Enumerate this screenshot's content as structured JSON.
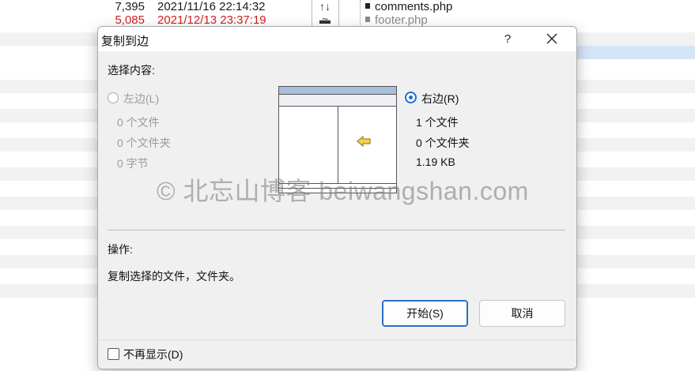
{
  "background": {
    "rows": [
      {
        "size": "7,395",
        "date": "2021/11/16 22:14:32",
        "mid": "↑↓ ▬",
        "file": "comments.php",
        "red": false,
        "gray": false
      },
      {
        "size": "5,085",
        "date": "2021/12/13 23:37:19",
        "mid": "≈",
        "file": "footer.php",
        "red": true,
        "gray": true
      }
    ]
  },
  "dialog": {
    "title": "复制到边",
    "help_label": "?",
    "close_label": "✕",
    "content_label": "选择内容:",
    "left": {
      "label": "左边(L)",
      "files": "0 个文件",
      "folders": "0 个文件夹",
      "bytes": "0 字节"
    },
    "right": {
      "label": "右边(R)",
      "files": "1 个文件",
      "folders": "0 个文件夹",
      "bytes": "1.19 KB"
    },
    "operation_label": "操作:",
    "operation_desc": "复制选择的文件，文件夹。",
    "start_button": "开始(S)",
    "cancel_button": "取消",
    "dont_show_label": "不再显示(D)"
  },
  "watermark": "© 北忘山博客 beiwangshan.com",
  "colors": {
    "accent": "#1a6fd1",
    "highlight_row": "#d6e4f7",
    "diff_red": "#d42020",
    "illustration_header": "#a8bedd",
    "arrow": "#f3d24a"
  },
  "selected_side": "right"
}
